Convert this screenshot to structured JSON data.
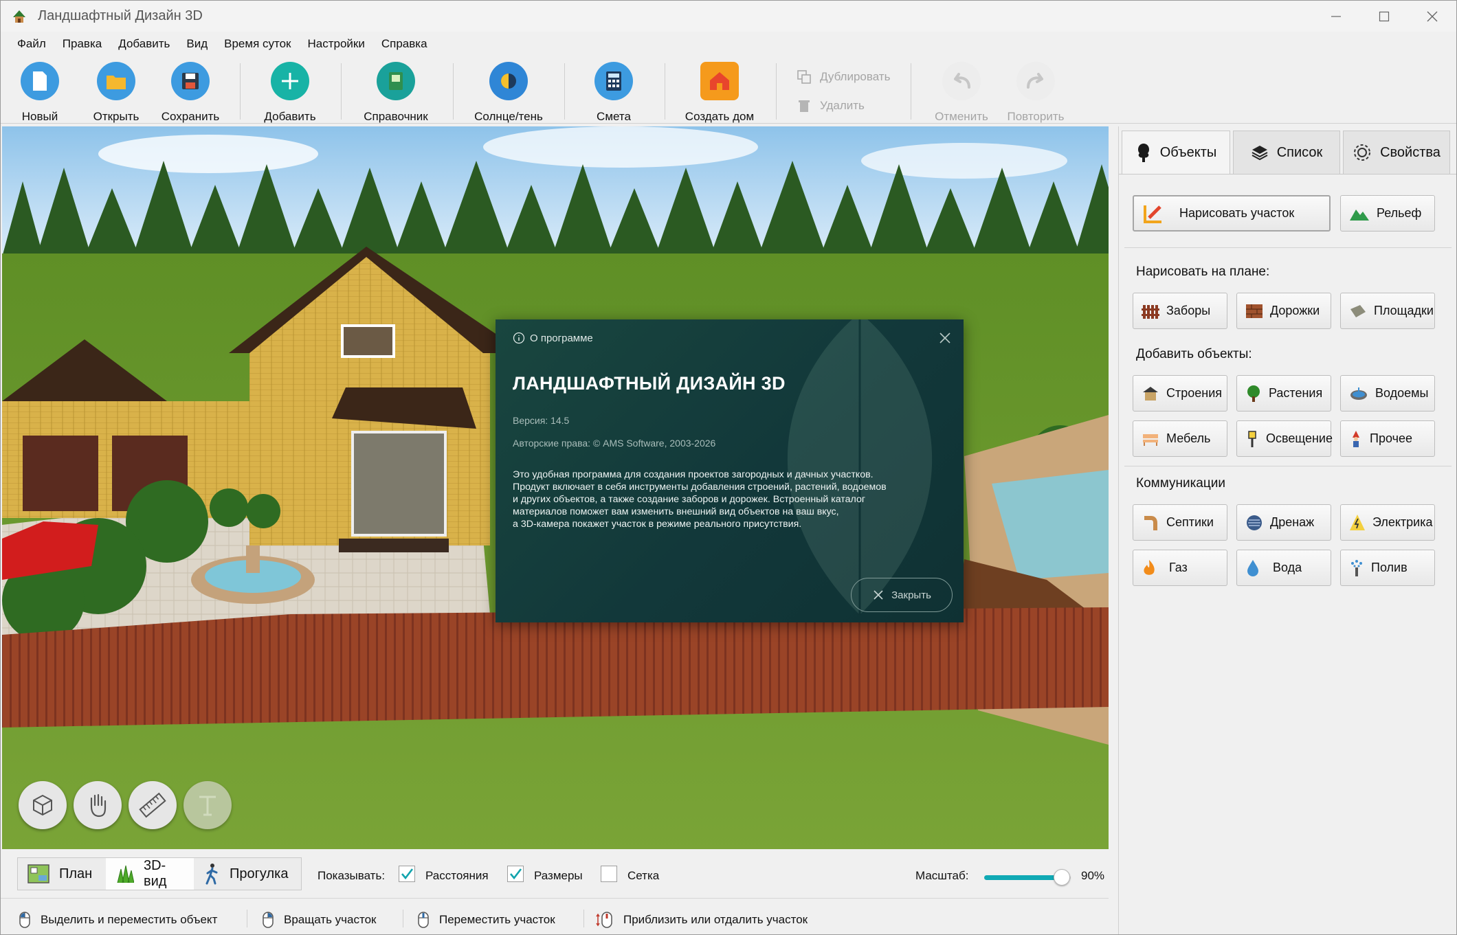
{
  "window": {
    "title": "Ландшафтный Дизайн 3D"
  },
  "menu": [
    "Файл",
    "Правка",
    "Добавить",
    "Вид",
    "Время суток",
    "Настройки",
    "Справка"
  ],
  "toolbar": {
    "new": "Новый",
    "open": "Открыть",
    "save": "Сохранить",
    "add": "Добавить",
    "reference": "Справочник",
    "sun_shade": "Солнце/тень",
    "estimate": "Смета",
    "create_house": "Создать дом",
    "duplicate": "Дублировать",
    "delete": "Удалить",
    "undo": "Отменить",
    "redo": "Повторить"
  },
  "about_dialog": {
    "header": "О программе",
    "product_name": "ЛАНДШАФТНЫЙ ДИЗАЙН 3D",
    "version": "Версия: 14.5",
    "copyright": "Авторские права: © AMS Software, 2003-2026",
    "description_lines": [
      "Это удобная программа для создания проектов загородных и дачных участков.",
      "Продукт включает в себя инструменты добавления строений, растений, водоемов",
      "и других объектов, а также создание заборов и дорожек. Встроенный каталог",
      "материалов поможет вам изменить внешний вид объектов на ваш вкус,",
      "а 3D-камера покажет участок в режиме реального присутствия."
    ],
    "close_label": "Закрыть"
  },
  "view_modes": {
    "plan": "План",
    "view3d": "3D-вид",
    "walk": "Прогулка",
    "active": "3D-вид"
  },
  "show": {
    "label": "Показывать:",
    "distances": {
      "label": "Расстояния",
      "checked": true
    },
    "sizes": {
      "label": "Размеры",
      "checked": true
    },
    "grid": {
      "label": "Сетка",
      "checked": false
    }
  },
  "scale": {
    "label": "Масштаб:",
    "value_text": "90%",
    "value": 0.9
  },
  "status": {
    "select_move": "Выделить и переместить объект",
    "rotate": "Вращать участок",
    "move": "Переместить участок",
    "zoom": "Приблизить или отдалить участок"
  },
  "panel": {
    "tabs": [
      "Объекты",
      "Список",
      "Свойства"
    ],
    "active_tab": "Объекты",
    "draw_plot": "Нарисовать участок",
    "relief": "Рельеф",
    "draw_on_plan": {
      "title": "Нарисовать на плане:",
      "items": [
        "Заборы",
        "Дорожки",
        "Площадки"
      ]
    },
    "add_objects": {
      "title": "Добавить объекты:",
      "items": [
        "Строения",
        "Растения",
        "Водоемы",
        "Мебель",
        "Освещение",
        "Прочее"
      ]
    },
    "communications": {
      "title": "Коммуникации",
      "items": [
        "Септики",
        "Дренаж",
        "Электрика",
        "Газ",
        "Вода",
        "Полив"
      ]
    }
  },
  "colors": {
    "accent_teal": "#10a9b4",
    "dialog_bg": "#17403c",
    "fence": "#8b3a22",
    "grass": "#6e9b2e"
  }
}
